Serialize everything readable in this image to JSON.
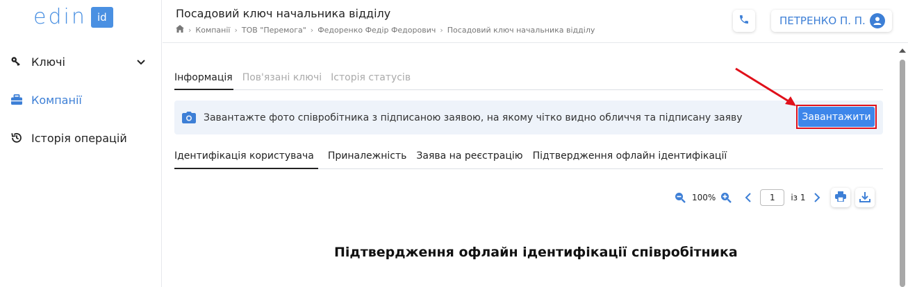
{
  "logo": {
    "text": "edin",
    "badge": "id"
  },
  "sidebar": {
    "items": [
      {
        "label": "Ключі",
        "icon": "key-icon",
        "active": false
      },
      {
        "label": "Компанії",
        "icon": "briefcase-icon",
        "active": true
      },
      {
        "label": "Історія операцій",
        "icon": "history-icon",
        "active": false
      }
    ]
  },
  "header": {
    "title": "Посадовий ключ начальника відділу",
    "breadcrumb": [
      "Компанії",
      "ТОВ \"Перемога\"",
      "Федоренко Федір Федорович",
      "Посадовий ключ начальника відділу"
    ],
    "user_name": "ПЕТРЕНКО П. П."
  },
  "tabs_main": [
    {
      "label": "Інформація",
      "active": true
    },
    {
      "label": "Пов'язані ключі",
      "active": false
    },
    {
      "label": "Історія статусів",
      "active": false
    }
  ],
  "banner": {
    "message": "Завантажте фото співробітника з підписаною заявою, на якому чітко видно обличчя та підписану заяву",
    "button_label": "Завантажити"
  },
  "tabs_doc": [
    {
      "label": "Ідентифікація користувача",
      "active": true
    },
    {
      "label": "Приналежність",
      "active": false
    },
    {
      "label": "Заява на реєстрацію",
      "active": false
    },
    {
      "label": "Підтвердження офлайн ідентифікації",
      "active": false
    }
  ],
  "viewer": {
    "zoom": "100%",
    "page_current": "1",
    "page_total_label": "із 1"
  },
  "document": {
    "heading": "Підтвердження офлайн ідентифікації співробітника"
  },
  "colors": {
    "accent": "#3d7fd6",
    "button": "#3d86ea",
    "highlight": "#e0101a",
    "banner_bg": "#eef3fa"
  }
}
